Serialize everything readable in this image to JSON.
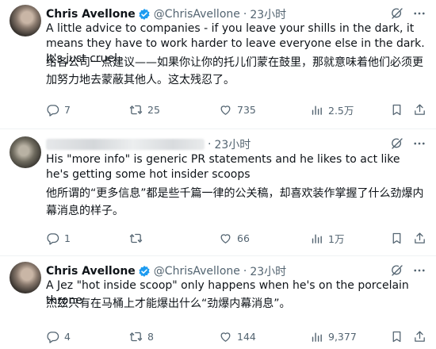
{
  "tweets": [
    {
      "name": "Chris Avellone",
      "handle": "@ChrisAvellone",
      "separator": "·",
      "time": "23小时",
      "text_en": "A little advice to companies - if you leave your shills in the dark, it means they have to work harder to leave everyone else in the dark. It's just cruel.",
      "text_cn": "给各公司一点建议——如果你让你的托儿们蒙在鼓里，那就意味着他们必须更加努力地去蒙蔽其他人。这太残忍了。",
      "replies": "7",
      "retweets": "25",
      "likes": "735",
      "views": "2.5万"
    },
    {
      "name": "",
      "handle": "",
      "separator": "·",
      "time": "23小时",
      "text_en": "His \"more info\" is generic PR statements and he likes to act like he's getting some hot insider scoops",
      "text_cn": "他所谓的“更多信息”都是些千篇一律的公关稿，却喜欢装作掌握了什么劲爆内幕消息的样子。",
      "replies": "1",
      "retweets": "",
      "likes": "66",
      "views": "1万"
    },
    {
      "name": "Chris Avellone",
      "handle": "@ChrisAvellone",
      "separator": "·",
      "time": "23小时",
      "text_en": "A Jez \"hot inside scoop\" only happens when he's on the porcelain throne",
      "text_cn": "杰兹只有在马桶上才能爆出什么“劲爆内幕消息”。",
      "replies": "4",
      "retweets": "8",
      "likes": "144",
      "views": "9,377"
    }
  ],
  "colors": {
    "text": "#0f1419",
    "secondary": "#536471",
    "verified": "#1d9bf0",
    "divider": "#eff3f4"
  },
  "icons": [
    "verified-badge-icon",
    "grok-icon",
    "more-icon",
    "reply-icon",
    "retweet-icon",
    "like-icon",
    "views-icon",
    "bookmark-icon",
    "share-icon"
  ]
}
